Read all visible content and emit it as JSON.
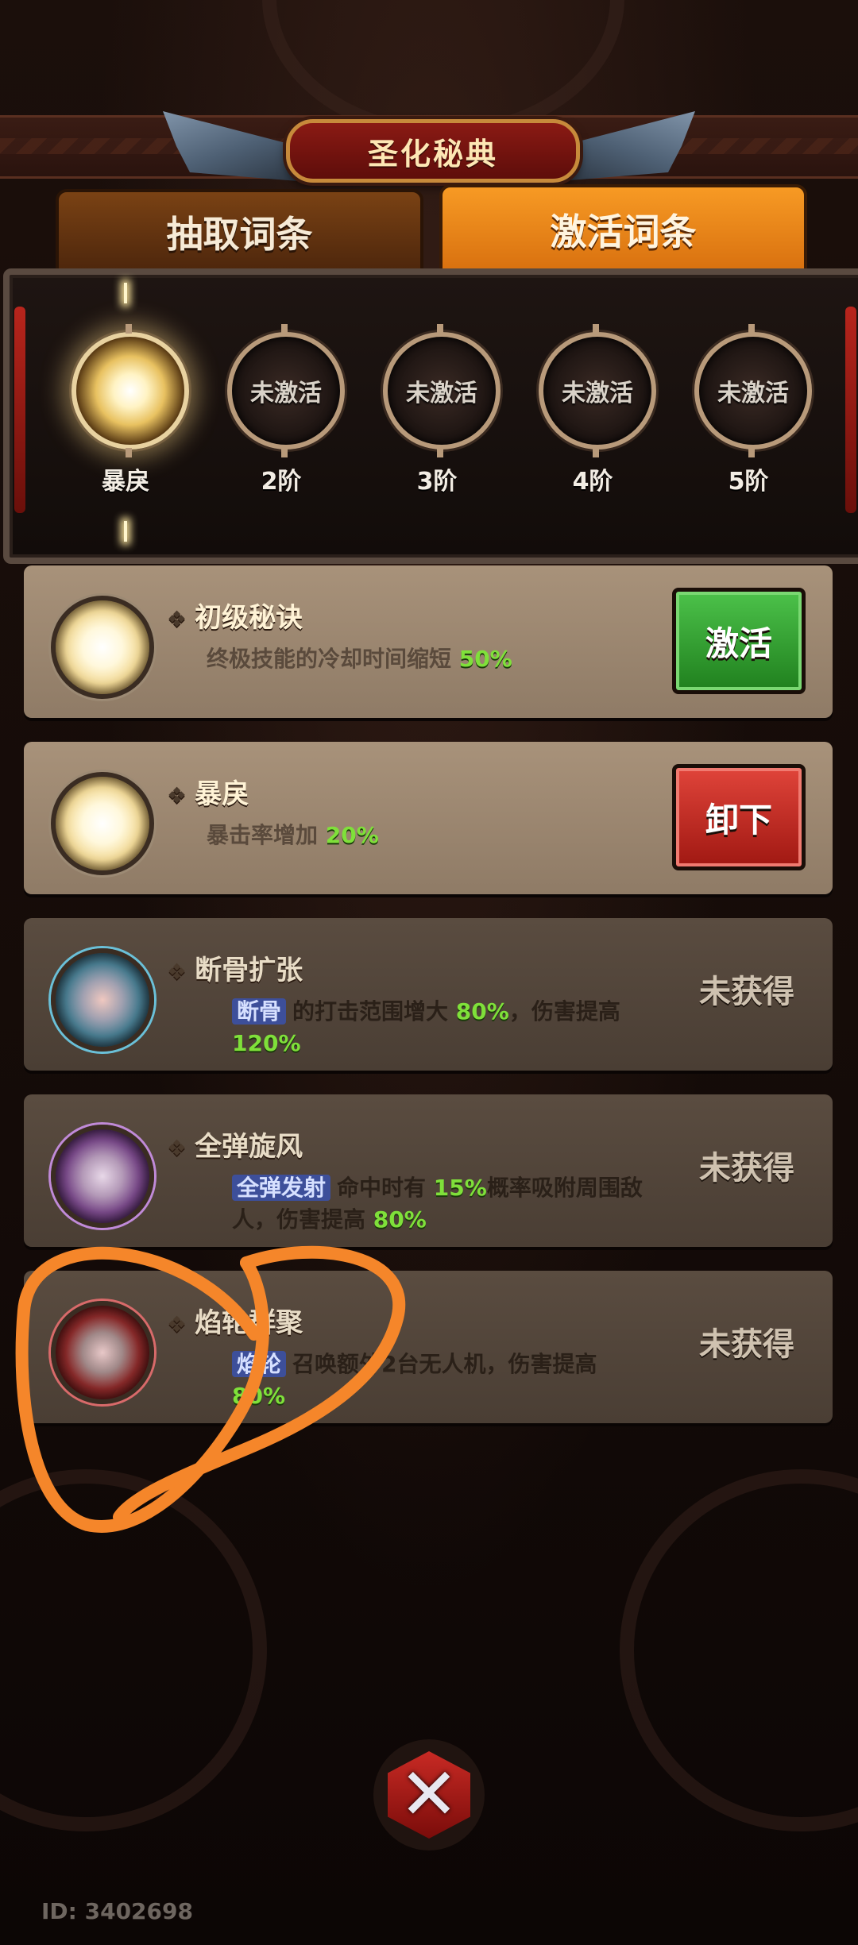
{
  "header": {
    "title": "圣化秘典"
  },
  "tabs": [
    {
      "label": "抽取词条",
      "selected": false
    },
    {
      "label": "激活词条",
      "selected": true
    }
  ],
  "tiers": [
    {
      "label": "暴戾",
      "ring_text": "",
      "active": true
    },
    {
      "label": "2阶",
      "ring_text": "未激活",
      "active": false
    },
    {
      "label": "3阶",
      "ring_text": "未激活",
      "active": false
    },
    {
      "label": "4阶",
      "ring_text": "未激活",
      "active": false
    },
    {
      "label": "5阶",
      "ring_text": "未激活",
      "active": false
    }
  ],
  "cards": [
    {
      "title": "初级秘诀",
      "icon": "gold-orb-icon",
      "desc_pre": "终极技能的冷却时间缩短",
      "pct1": "50%",
      "button": "激活",
      "button_color": "#20801e"
    },
    {
      "title": "暴戾",
      "icon": "gold-lightning-orb-icon",
      "desc_pre": "暴击率增加",
      "pct1": "20%",
      "button": "卸下",
      "button_color": "#a01812"
    },
    {
      "title": "断骨扩张",
      "icon": "blue-orb-icon",
      "tag": "断骨",
      "desc_pre": "的打击范围增大",
      "pct1": "80%",
      "desc_mid": "，伤害提高",
      "pct2": "120%",
      "status": "未获得"
    },
    {
      "title": "全弹旋风",
      "icon": "purple-orb-icon",
      "tag": "全弹发射",
      "desc_pre": "命中时有",
      "pct1": "15%",
      "desc_mid": "概率吸附周围敌人，伤害提高",
      "pct2": "80%",
      "status": "未获得"
    },
    {
      "title": "焰轮群聚",
      "icon": "red-orb-icon",
      "tag": "焰轮",
      "desc_pre": "召唤额外2台无人机，伤害提高",
      "pct1": "80%",
      "status": "未获得"
    }
  ],
  "footer": {
    "close_icon": "close-icon",
    "id_text": "ID: 3402698"
  },
  "colors": {
    "annotation": "#f5862a",
    "accent_tab": "#f79a24",
    "green_pct": "#7fe03a"
  }
}
